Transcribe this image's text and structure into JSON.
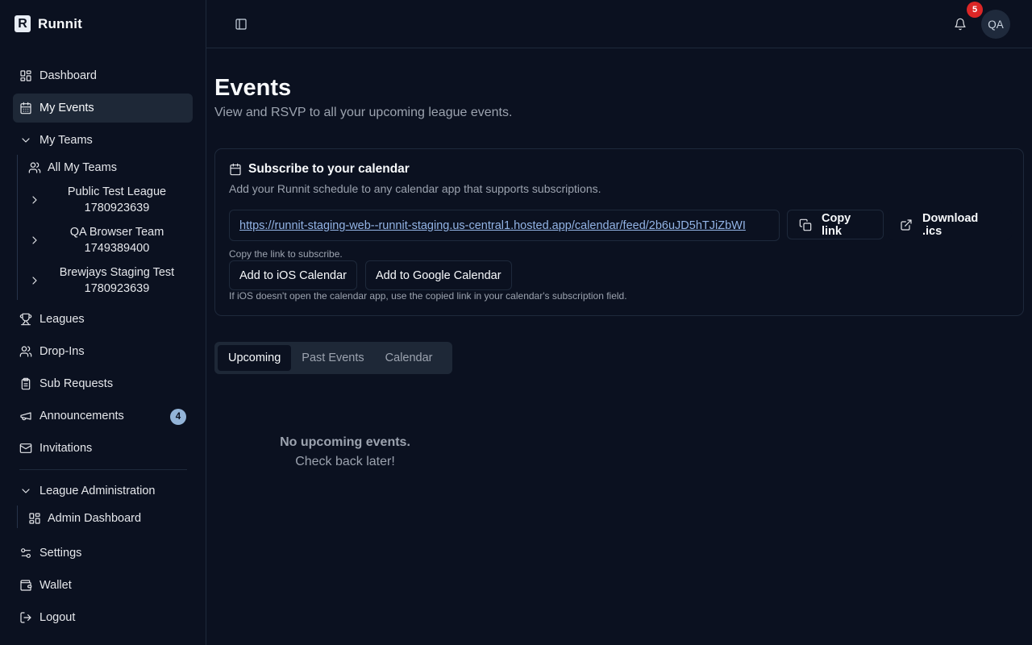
{
  "brand": {
    "name": "Runnit",
    "logo_letter": "R"
  },
  "sidebar": {
    "dashboard": "Dashboard",
    "my_events": "My Events",
    "my_teams": "My Teams",
    "all_my_teams": "All My Teams",
    "teams": [
      {
        "line1": "Public Test League",
        "line2": "1780923639"
      },
      {
        "line1": "QA Browser Team",
        "line2": "1749389400"
      },
      {
        "line1": "Brewjays Staging Test",
        "line2": "1780923639"
      }
    ],
    "leagues": "Leagues",
    "drop_ins": "Drop-Ins",
    "sub_requests": "Sub Requests",
    "announcements": "Announcements",
    "announcements_count": "4",
    "invitations": "Invitations",
    "league_admin": "League Administration",
    "admin_dashboard": "Admin Dashboard",
    "settings": "Settings",
    "wallet": "Wallet",
    "logout": "Logout"
  },
  "topbar": {
    "notifications_count": "5",
    "avatar_initials": "QA"
  },
  "page": {
    "title": "Events",
    "subtitle": "View and RSVP to all your upcoming league events."
  },
  "calendar_card": {
    "title": "Subscribe to your calendar",
    "description": "Add your Runnit schedule to any calendar app that supports subscriptions.",
    "feed_url": "https://runnit-staging-web--runnit-staging.us-central1.hosted.app/calendar/feed/2b6uJD5hTJiZbWI",
    "copy_label": "Copy link",
    "download_label": "Download .ics",
    "copy_hint": "Copy the link to subscribe.",
    "ios_label": "Add to iOS Calendar",
    "google_label": "Add to Google Calendar",
    "ios_hint": "If iOS doesn't open the calendar app, use the copied link in your calendar's subscription field."
  },
  "tabs": {
    "upcoming": "Upcoming",
    "past": "Past Events",
    "calendar": "Calendar"
  },
  "empty_state": {
    "line1": "No upcoming events.",
    "line2": "Check back later!"
  }
}
